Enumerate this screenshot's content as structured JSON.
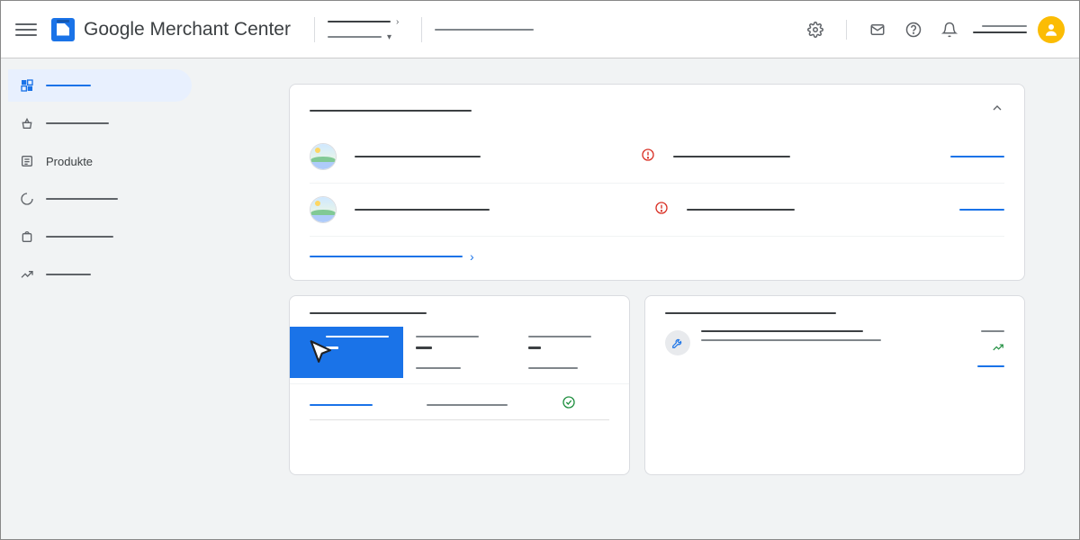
{
  "header": {
    "app_title": "Google Merchant Center"
  },
  "sidebar": {
    "items": [
      {
        "label": "",
        "icon": "dashboard"
      },
      {
        "label": "",
        "icon": "basket"
      },
      {
        "label": "Produkte",
        "icon": "list"
      },
      {
        "label": "",
        "icon": "spinner"
      },
      {
        "label": "",
        "icon": "bag"
      },
      {
        "label": "",
        "icon": "growth"
      }
    ]
  },
  "colors": {
    "primary": "#1a73e8",
    "danger": "#d93025",
    "success": "#1e8e3e",
    "avatar": "#fbbc04"
  }
}
